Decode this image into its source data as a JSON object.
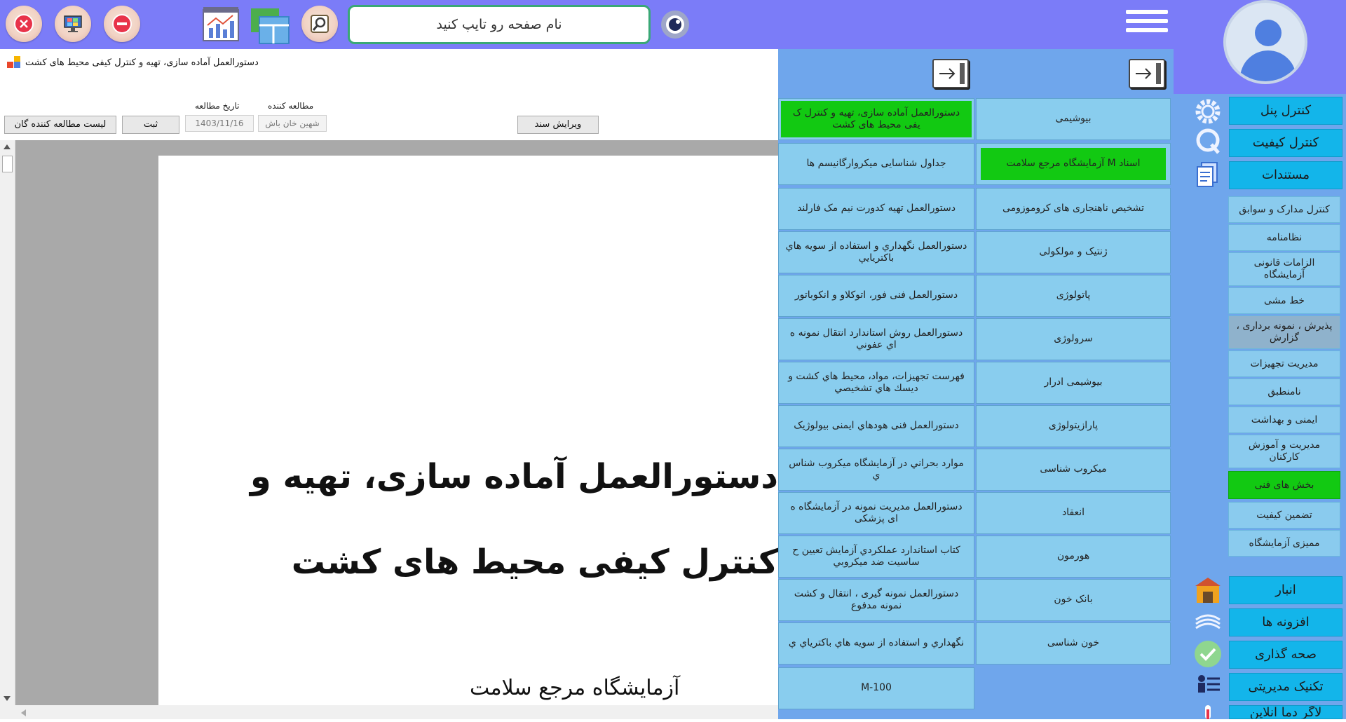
{
  "topbar": {
    "search_placeholder": "نام صفحه رو تایپ کنید",
    "icons": [
      "close-circle-icon",
      "monitor-icon",
      "minus-circle-icon",
      "chart-report-icon",
      "table-window-icon",
      "search-magnifier-icon",
      "eye-toggle-icon",
      "hamburger-menu-icon"
    ]
  },
  "document": {
    "window_title": "دستورالعمل آماده سازی، تهیه و کنترل کیفی محیط های کشت",
    "reader_label": "مطالعه کننده",
    "reader_value": "شهین خان باش",
    "date_label": "تاریخ مطالعه",
    "date_value": "1403/11/16",
    "submit_button": "ثبت",
    "readers_list_button": "لیست مطالعه کننده گان",
    "edit_button": "ویرایش سند",
    "page_text_1": "دستورالعمل آماده سازی، تهیه و",
    "page_text_2": "کنترل کیفی محیط های کشت",
    "page_text_3": "آزمایشگاه مرجع سلامت"
  },
  "categories_col": [
    "بیوشیمی",
    "اسناد M آزمایشگاه مرجع سلامت",
    "تشخیص ناهنجاری های کروموزومی",
    "ژنتیک و مولکولی",
    "پاتولوژی",
    "سرولوژی",
    "بیوشیمی ادرار",
    "پارازیتولوژی",
    "میکروب شناسی",
    "انعقاد",
    "هورمون",
    "بانک خون",
    "خون شناسی"
  ],
  "documents_col": [
    "دستورالعمل آماده سازی، تهیه و کنترل ک یفی محیط های کشت",
    "جداول شناسایی میکروارگانیسم ها",
    "دستورالعمل تهیه کدورت نیم مک فارلند",
    "دستورالعمل نگهداري و استفاده از سويه هاي باكتريايي",
    "دستورالعمل فنی فور، اتوکلاو و انکوباتور",
    "دستورالعمل روش استاندارد انتقال نمونه ه اي عفوني",
    "فهرست تجهيزات، مواد، محيط هاي كشت و ديسك هاي تشخيصي",
    "دستورالعمل فنی هودهاي ايمنی بيولوژيک",
    "موارد بحراني در آزمایشگاه میکروب شناس ي",
    "دستورالعمل مديريت نمونه در آزمایشگاه ه ای پزشکی",
    "كتاب استاندارد عملكردي آزمايش تعيين ح ساسيت ضد ميكروبي",
    "دستورالعمل نمونه گیری ، انتقال و کشت نمونه مدفوع",
    "نگهداري و استفاده از سويه هاي باكترياي ي",
    "M-100"
  ],
  "nav_main": {
    "control_panel": "کنترل پنل",
    "quality_control": "کنترل کیفیت",
    "documents": "مستندات",
    "warehouse": "انبار",
    "addons": "افزونه ها",
    "validation": "صحه گذاری",
    "management_technique": "تکنیک مدیریتی",
    "online_temp_log": "لاگر دما آنلاین"
  },
  "nav_sub": [
    "کنترل مدارک و سوابق",
    "نظامنامه",
    "الزامات قانونی آزمایشگاه",
    "خط مشی",
    "پذیرش ، نمونه برداری ، گزارش",
    "مدیریت تجهیزات",
    "نامنطبق",
    "ایمنی و بهداشت",
    "مدیریت و آموزش کارکنان",
    "بخش های فنی",
    "تضمین کیفیت",
    "ممیزی آزمایشگاه"
  ],
  "colors": {
    "topbar": "#7b7cf8",
    "panel": "#6fa6ec",
    "cell": "#89cdee",
    "active_green": "#12c912",
    "nav_button": "#13b5ea"
  }
}
